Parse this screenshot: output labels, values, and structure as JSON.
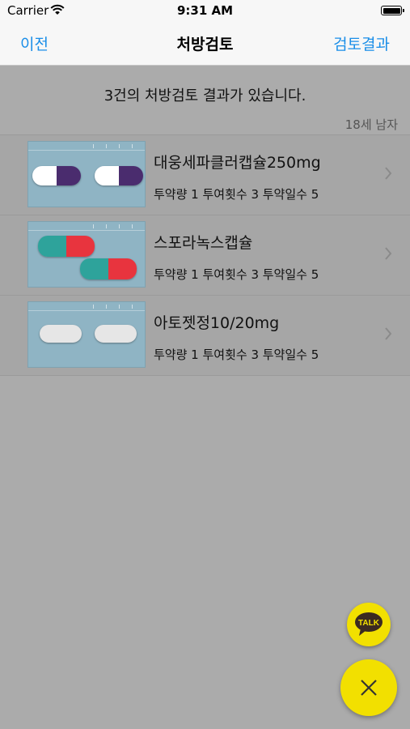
{
  "status_bar": {
    "carrier": "Carrier",
    "time": "9:31 AM"
  },
  "nav": {
    "back_label": "이전",
    "title": "처방검토",
    "right_label": "검토결과"
  },
  "summary": "3건의 처방검토 결과가 있습니다.",
  "patient_info": "18세 남자",
  "prescriptions": [
    {
      "name": "대웅세파클러캡슐250mg",
      "dosage": "투약량 1  투여횟수 3  투약일수 5",
      "pill_colors": [
        "#ffffff",
        "#4a2c6e"
      ]
    },
    {
      "name": "스포라녹스캡슐",
      "dosage": "투약량 1  투여횟수 3  투약일수 5",
      "pill_colors": [
        "#2ea39b",
        "#e8343e"
      ]
    },
    {
      "name": "아토젯정10/20mg",
      "dosage": "투약량 1  투여횟수 3  투약일수 5",
      "pill_colors": [
        "#e6e6e6",
        "#e6e6e6"
      ]
    }
  ],
  "fab": {
    "talk_label": "TALK",
    "talk_icon": "kakaotalk-icon",
    "close_icon": "close-icon"
  },
  "colors": {
    "accent": "#1a8ee8",
    "fab": "#f2e000"
  }
}
